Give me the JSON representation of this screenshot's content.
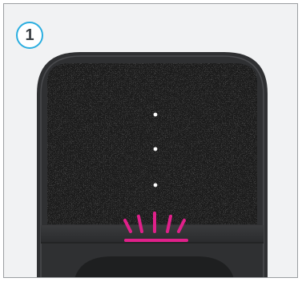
{
  "step_badge": {
    "number": "1",
    "ring_color": "#2aaee0"
  },
  "device": {
    "type": "smart-speaker-top-view",
    "grille_texture": "dark-speckled-fabric",
    "indicator_dots": 3,
    "indicator_dot_color": "#ffffff",
    "status_light_color": "#e0208a",
    "status_light_state": "pulsing"
  }
}
